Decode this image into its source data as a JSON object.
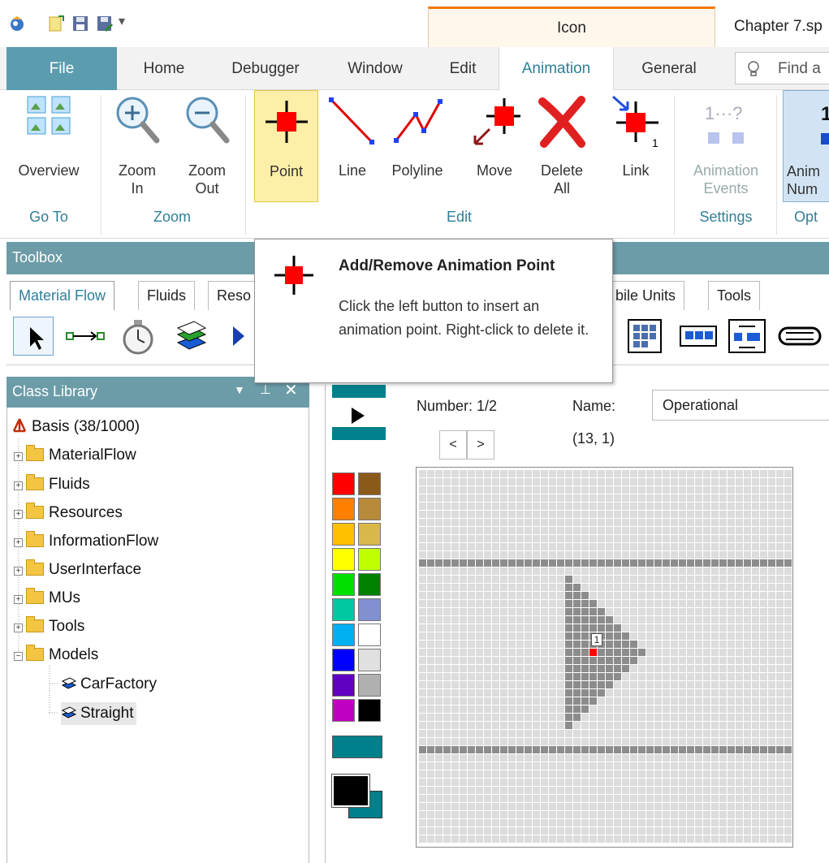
{
  "titlebar": {
    "context_tab": "Icon",
    "doc_title": "Chapter 7.sp"
  },
  "tabs": {
    "file": "File",
    "home": "Home",
    "debugger": "Debugger",
    "window": "Window",
    "edit": "Edit",
    "animation": "Animation",
    "general": "General",
    "search_placeholder": "Find a"
  },
  "ribbon": {
    "overview": "Overview",
    "zoom_in_1": "Zoom",
    "zoom_in_2": "In",
    "zoom_out_1": "Zoom",
    "zoom_out_2": "Out",
    "point": "Point",
    "line": "Line",
    "polyline": "Polyline",
    "move": "Move",
    "delete_1": "Delete",
    "delete_2": "All",
    "link": "Link",
    "anim_events_1": "Animation",
    "anim_events_2": "Events",
    "anim_num_1": "Anim",
    "anim_num_2": "Num",
    "groups": {
      "goto": "Go To",
      "zoom": "Zoom",
      "edit": "Edit",
      "settings": "Settings",
      "options": "Opt"
    }
  },
  "toolbox": {
    "title": "Toolbox",
    "tabs": [
      "Material Flow",
      "Fluids",
      "Reso",
      "bile Units",
      "Tools"
    ]
  },
  "tooltip": {
    "title": "Add/Remove Animation Point",
    "body": "Click the left button to insert an animation point. Right-click to delete it."
  },
  "class_library": {
    "title": "Class Library",
    "root": "Basis (38/1000)",
    "folders": [
      "MaterialFlow",
      "Fluids",
      "Resources",
      "InformationFlow",
      "UserInterface",
      "MUs",
      "Tools",
      "Models"
    ],
    "models": [
      "CarFactory",
      "Straight"
    ]
  },
  "editor": {
    "number_label": "Number: 1/2",
    "name_label": "Name:",
    "name_value": "Operational",
    "prev_btn": "<",
    "next_btn": ">",
    "coords": "(13, 1)",
    "point_label": "1"
  },
  "palette": {
    "left": [
      "#ff0000",
      "#ff8000",
      "#ffc000",
      "#ffff00",
      "#00e000",
      "#00c8a0",
      "#00b0f0",
      "#0000ff",
      "#6000c0",
      "#c000c0"
    ],
    "right": [
      "#8b5a1a",
      "#b88a3c",
      "#d9b84a",
      "#c0ff00",
      "#008000",
      "#8090d0",
      "#ffffff",
      "#e0e0e0",
      "#b0b0b0",
      "#000000"
    ],
    "teal": "#00808a"
  },
  "colors": {
    "accent": "#2f7f97",
    "panel_header": "#6c9ca8",
    "point_red": "#ff0000"
  }
}
